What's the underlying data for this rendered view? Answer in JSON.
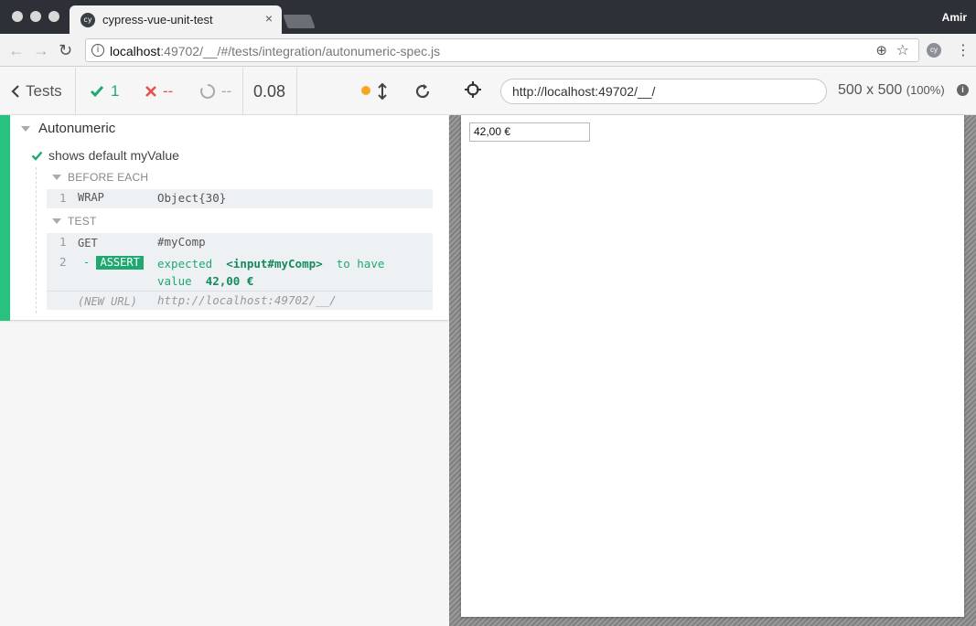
{
  "browser": {
    "tab_title": "cypress-vue-unit-test",
    "tab_favicon": "cy",
    "tab_close": "×",
    "user": "Amir",
    "url_host": "localhost",
    "url_path": ":49702/__/#/tests/integration/autonumeric-spec.js",
    "info_glyph": "i",
    "ext_glyph": "cy",
    "back_icon": "←",
    "forward_icon": "→",
    "reload_icon": "↻",
    "zoom_icon": "⊕",
    "star_icon": "☆",
    "menu_icon": "⋮"
  },
  "reporter": {
    "back_label": "Tests",
    "passed_count": "1",
    "failed_count": "--",
    "pending_count": "--",
    "duration": "0.08"
  },
  "aut": {
    "url": "http://localhost:49702/__/",
    "viewport_size": "500 x 500",
    "viewport_pct": "(100%)",
    "info_glyph": "i"
  },
  "suite": {
    "title": "Autonumeric",
    "test_title": "shows default myValue",
    "before_each_label": "BEFORE EACH",
    "test_label": "TEST",
    "before_each_commands": [
      {
        "num": "1",
        "name": "WRAP",
        "message": "Object{30}"
      }
    ],
    "test_commands": [
      {
        "num": "1",
        "name": "GET",
        "message": "#myComp"
      },
      {
        "num": "2",
        "dash": "-",
        "name": "ASSERT",
        "msg_expected": "expected",
        "msg_selector": "<input#myComp>",
        "msg_to_have": "to have",
        "msg_value_word": "value",
        "msg_value": "42,00 €"
      }
    ],
    "new_url": {
      "name": "(NEW URL)",
      "message": "http://localhost:49702/__/"
    }
  },
  "component": {
    "input_value": "42,00 €"
  },
  "colors": {
    "passed": "#1fa971",
    "failed": "#e94f4f",
    "running": "#f5a623",
    "suite_bar": "#27c27f"
  }
}
